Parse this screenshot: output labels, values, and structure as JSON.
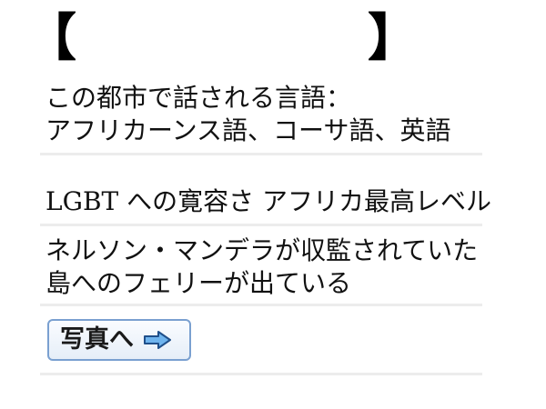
{
  "header": {
    "bracket_left": "【",
    "bracket_right": "】",
    "title": ""
  },
  "languages": {
    "line1": "この都市で話される言語：",
    "line2": "アフリカーンス語、コーサ語、英語"
  },
  "lgbt": {
    "text": "LGBT への寛容さ アフリカ最高レベル"
  },
  "ferry": {
    "line1": "ネルソン・マンデラが収監されていた",
    "line2": "島へのフェリーが出ている"
  },
  "photo_button": {
    "label": "写真へ",
    "icon": "right-arrow-icon",
    "border_color": "#7aa0d0",
    "arrow_color": "#6fb4ee"
  }
}
